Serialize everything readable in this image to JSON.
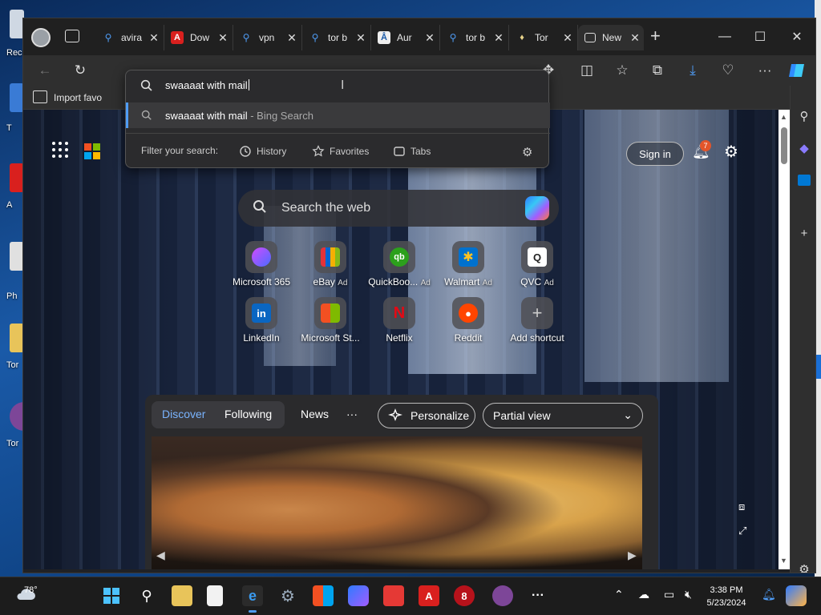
{
  "desktop": {
    "icons": [
      {
        "label": "Rec"
      },
      {
        "label": "T"
      },
      {
        "label": "A"
      },
      {
        "label": "Ph"
      },
      {
        "label": "Tor"
      },
      {
        "label": "Tor"
      }
    ]
  },
  "browser": {
    "tabs": [
      {
        "label": "avira",
        "icon": "bing-search-icon"
      },
      {
        "label": "Dow",
        "icon": "avira-icon"
      },
      {
        "label": "vpn",
        "icon": "bing-search-icon"
      },
      {
        "label": "tor b",
        "icon": "bing-search-icon"
      },
      {
        "label": "Aur",
        "icon": "accessibility-icon"
      },
      {
        "label": "tor b",
        "icon": "bing-search-icon"
      },
      {
        "label": "Tor",
        "icon": "tor-icon"
      },
      {
        "label": "New",
        "icon": "newtab-icon",
        "active": true
      }
    ],
    "favorites_bar": {
      "import_label": "Import favo"
    },
    "omnibox": {
      "query": "swaaaat with mail",
      "suggestion_query": "swaaaat with mail",
      "suggestion_source": "- Bing Search",
      "filter_label": "Filter your search:",
      "filters": [
        "History",
        "Favorites",
        "Tabs"
      ]
    }
  },
  "newtab": {
    "signin_label": "Sign in",
    "notification_count": "7",
    "search_placeholder": "Search the web",
    "shortcuts": [
      {
        "label": "Microsoft 365",
        "ad": "",
        "glyph": "",
        "color": "#7b5cff"
      },
      {
        "label": "eBay",
        "ad": "Ad",
        "glyph": "",
        "color": "#e53238"
      },
      {
        "label": "QuickBoo...",
        "ad": "Ad",
        "glyph": "qb",
        "color": "#2ca01c"
      },
      {
        "label": "Walmart",
        "ad": "Ad",
        "glyph": "✱",
        "color": "#0071ce"
      },
      {
        "label": "QVC",
        "ad": "Ad",
        "glyph": "Q",
        "color": "#ffffff"
      },
      {
        "label": "LinkedIn",
        "ad": "",
        "glyph": "in",
        "color": "#0a66c2"
      },
      {
        "label": "Microsoft St...",
        "ad": "",
        "glyph": "",
        "color": "#0078d4"
      },
      {
        "label": "Netflix",
        "ad": "",
        "glyph": "N",
        "color": "#e50914"
      },
      {
        "label": "Reddit",
        "ad": "",
        "glyph": "●",
        "color": "#ff4500"
      },
      {
        "label": "Add shortcut",
        "ad": "",
        "glyph": "+",
        "color": "transparent"
      }
    ],
    "news": {
      "tabs": [
        "Discover",
        "Following",
        "News"
      ],
      "more": "···",
      "personalize_label": "Personalize",
      "view_label": "Partial view"
    }
  },
  "taskbar": {
    "weather_temp": "78°",
    "time": "3:38 PM",
    "date": "5/23/2024"
  },
  "colors": {
    "accent": "#4f9cf5",
    "tab_bg": "#202020",
    "toolbar_bg": "#2f2f2f"
  }
}
